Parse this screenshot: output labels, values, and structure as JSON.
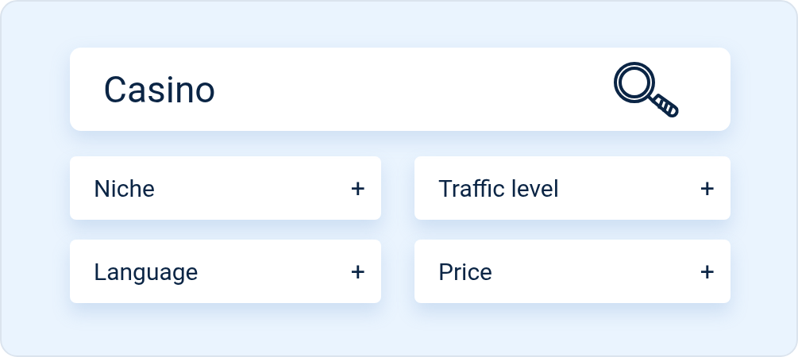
{
  "search": {
    "value": "Casino"
  },
  "filters": [
    {
      "label": "Niche",
      "icon": "+"
    },
    {
      "label": "Traffic level",
      "icon": "+"
    },
    {
      "label": "Language",
      "icon": "+"
    },
    {
      "label": "Price",
      "icon": "+"
    }
  ]
}
